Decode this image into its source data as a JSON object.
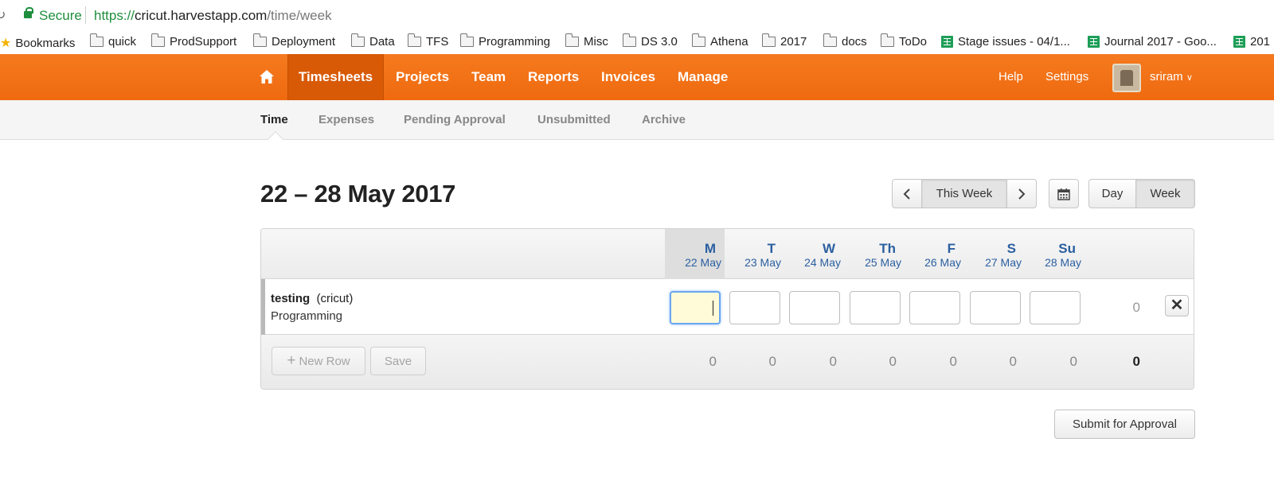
{
  "browser": {
    "secure_label": "Secure",
    "url_scheme": "https://",
    "url_host": "cricut.harvestapp.com",
    "url_path": "/time/week"
  },
  "bookmarks": [
    {
      "label": "Bookmarks",
      "icon": "star-icon"
    },
    {
      "label": "quick",
      "icon": "folder-icon"
    },
    {
      "label": "ProdSupport",
      "icon": "folder-icon"
    },
    {
      "label": "Deployment",
      "icon": "folder-icon"
    },
    {
      "label": "Data",
      "icon": "folder-icon"
    },
    {
      "label": "TFS",
      "icon": "folder-icon"
    },
    {
      "label": "Programming",
      "icon": "folder-icon"
    },
    {
      "label": "Misc",
      "icon": "folder-icon"
    },
    {
      "label": "DS 3.0",
      "icon": "folder-icon"
    },
    {
      "label": "Athena",
      "icon": "folder-icon"
    },
    {
      "label": "2017",
      "icon": "folder-icon"
    },
    {
      "label": "docs",
      "icon": "folder-icon"
    },
    {
      "label": "ToDo",
      "icon": "folder-icon"
    },
    {
      "label": "Stage issues - 04/1...",
      "icon": "sheets-icon"
    },
    {
      "label": "Journal 2017 - Goo...",
      "icon": "sheets-icon"
    },
    {
      "label": "201",
      "icon": "sheets-icon"
    }
  ],
  "nav": {
    "items": [
      "Timesheets",
      "Projects",
      "Team",
      "Reports",
      "Invoices",
      "Manage"
    ],
    "active": "Timesheets",
    "help": "Help",
    "settings": "Settings",
    "user": "sriram",
    "brand_color": "#f36c10"
  },
  "subnav": {
    "items": [
      "Time",
      "Expenses",
      "Pending Approval",
      "Unsubmitted",
      "Archive"
    ],
    "active": "Time"
  },
  "header": {
    "title": "22 – 28 May 2017",
    "this_week": "This Week",
    "day": "Day",
    "week": "Week"
  },
  "days": [
    {
      "name": "M",
      "date": "22 May"
    },
    {
      "name": "T",
      "date": "23 May"
    },
    {
      "name": "W",
      "date": "24 May"
    },
    {
      "name": "Th",
      "date": "25 May"
    },
    {
      "name": "F",
      "date": "26 May"
    },
    {
      "name": "S",
      "date": "27 May"
    },
    {
      "name": "Su",
      "date": "28 May"
    }
  ],
  "row": {
    "project": "testing",
    "client": "(cricut)",
    "task": "Programming",
    "total": "0"
  },
  "footer": {
    "new_row": "New Row",
    "save": "Save",
    "day_totals": [
      "0",
      "0",
      "0",
      "0",
      "0",
      "0",
      "0"
    ],
    "grand_total": "0"
  },
  "submit": "Submit for Approval"
}
